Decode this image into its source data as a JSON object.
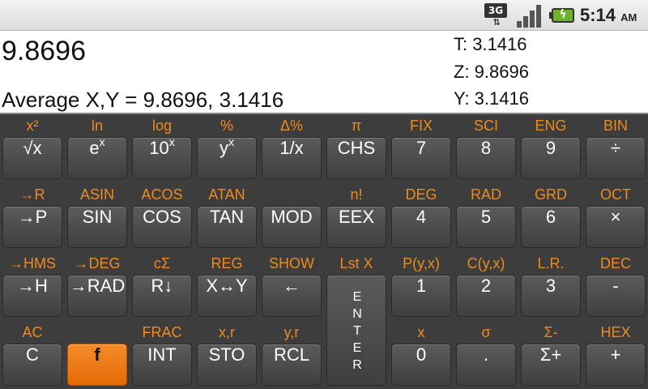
{
  "status_bar": {
    "network": "3G",
    "time": "5:14",
    "ampm": "AM",
    "icons": [
      "3g-data-icon",
      "signal-icon",
      "battery-charging-icon"
    ]
  },
  "display": {
    "x_value": "9.8696",
    "message": "Average X,Y = 9.8696, 3.1416",
    "stack_t": "T: 3.1416",
    "stack_z": "Z: 9.8696",
    "stack_y": "Y: 3.1416"
  },
  "colors": {
    "function_label": "#f08a1c",
    "key_background": "#4a4a4a",
    "shift_key": "#f07a14",
    "display_background": "#ffffff"
  },
  "keys": {
    "r1": [
      {
        "f": "x²",
        "k": "√x"
      },
      {
        "f": "ln",
        "k": "e",
        "sup": "x"
      },
      {
        "f": "log",
        "k": "10",
        "sup": "x"
      },
      {
        "f": "%",
        "k": "y",
        "sup": "x"
      },
      {
        "f": "Δ%",
        "k": "1/x"
      },
      {
        "f": "π",
        "k": "CHS"
      },
      {
        "f": "FIX",
        "k": "7"
      },
      {
        "f": "SCI",
        "k": "8"
      },
      {
        "f": "ENG",
        "k": "9"
      },
      {
        "f": "BIN",
        "k": "÷"
      }
    ],
    "r2": [
      {
        "f": "→R",
        "k": "→P"
      },
      {
        "f": "ASIN",
        "k": "SIN"
      },
      {
        "f": "ACOS",
        "k": "COS"
      },
      {
        "f": "ATAN",
        "k": "TAN"
      },
      {
        "f": "",
        "k": "MOD"
      },
      {
        "f": "n!",
        "k": "EEX"
      },
      {
        "f": "DEG",
        "k": "4"
      },
      {
        "f": "RAD",
        "k": "5"
      },
      {
        "f": "GRD",
        "k": "6"
      },
      {
        "f": "OCT",
        "k": "×"
      }
    ],
    "r3": [
      {
        "f": "→HMS",
        "k": "→H"
      },
      {
        "f": "→DEG",
        "k": "→RAD"
      },
      {
        "f": "cΣ",
        "k": "R↓"
      },
      {
        "f": "REG",
        "k": "X↔Y"
      },
      {
        "f": "SHOW",
        "k": "←"
      },
      {
        "f": "Lst X",
        "k": "ENTER"
      },
      {
        "f": "P(y,x)",
        "k": "1"
      },
      {
        "f": "C(y,x)",
        "k": "2"
      },
      {
        "f": "L.R.",
        "k": "3"
      },
      {
        "f": "DEC",
        "k": "-"
      }
    ],
    "r4": [
      {
        "f": "AC",
        "k": "C"
      },
      {
        "f": "",
        "k": "f"
      },
      {
        "f": "FRAC",
        "k": "INT"
      },
      {
        "f": "x,r",
        "k": "STO"
      },
      {
        "f": "y,r",
        "k": "RCL"
      },
      {
        "f": "",
        "k": ""
      },
      {
        "f": "x",
        "k": "0"
      },
      {
        "f": "σ",
        "k": "."
      },
      {
        "f": "Σ-",
        "k": "Σ+"
      },
      {
        "f": "HEX",
        "k": "+"
      }
    ],
    "enter_letters": [
      "E",
      "N",
      "T",
      "E",
      "R"
    ]
  }
}
